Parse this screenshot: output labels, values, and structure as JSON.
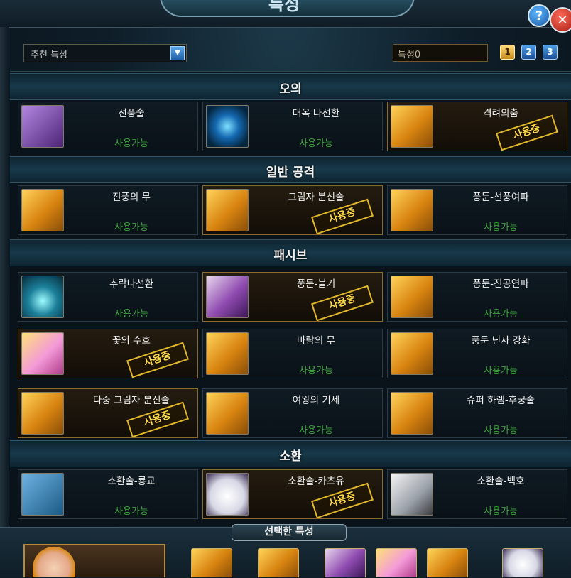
{
  "window": {
    "title": "특성",
    "help_label": "?",
    "close_label": "✕",
    "accent": "#1c5ca8",
    "used_color": "#ffd94b",
    "available_color": "#3fa43f"
  },
  "controls": {
    "preset_select": "추천 특성",
    "trait_name": "특성0",
    "pages": [
      "1",
      "2",
      "3"
    ],
    "active_page": "1"
  },
  "sections": [
    {
      "title": "오의",
      "skills": [
        {
          "name": "선풍술",
          "status": "사용가능",
          "icon": "tornado-icon"
        },
        {
          "name": "대옥 나선환",
          "status": "사용가능",
          "icon": "spiral-orb-icon"
        },
        {
          "name": "격려의춤",
          "status": "사용중",
          "icon": "dancer-icon"
        }
      ]
    },
    {
      "title": "일반 공격",
      "skills": [
        {
          "name": "진풍의 무",
          "status": "사용가능",
          "icon": "wind-swirl-icon"
        },
        {
          "name": "그림자 분신술",
          "status": "사용중",
          "icon": "shadow-clone-icon"
        },
        {
          "name": "풍둔-선풍여파",
          "status": "사용가능",
          "icon": "flame-wave-icon"
        }
      ]
    },
    {
      "title": "패시브",
      "skills": [
        {
          "name": "추락나선환",
          "status": "사용가능",
          "icon": "falling-spiral-icon"
        },
        {
          "name": "풍둔-불기",
          "status": "사용중",
          "icon": "fan-icon"
        },
        {
          "name": "풍둔-진공연파",
          "status": "사용가능",
          "icon": "vacuum-wave-icon"
        },
        {
          "name": "꽃의 수호",
          "status": "사용중",
          "icon": "flower-guard-icon"
        },
        {
          "name": "바람의 무",
          "status": "사용가능",
          "icon": "scroll-icon"
        },
        {
          "name": "풍둔 닌자 강화",
          "status": "사용가능",
          "icon": "wind-kanji-icon"
        },
        {
          "name": "다중 그림자 분신술",
          "status": "사용중",
          "icon": "multi-clone-icon"
        },
        {
          "name": "여왕의 기세",
          "status": "사용가능",
          "icon": "queen-icon"
        },
        {
          "name": "슈퍼 하렘-후궁술",
          "status": "사용가능",
          "icon": "harem-icon"
        }
      ]
    },
    {
      "title": "소환",
      "skills": [
        {
          "name": "소환술-룡교",
          "status": "사용가능",
          "icon": "dragon-icon"
        },
        {
          "name": "소환술-카츠유",
          "status": "사용중",
          "icon": "slug-icon"
        },
        {
          "name": "소환술-백호",
          "status": "사용가능",
          "icon": "white-tiger-icon"
        }
      ]
    }
  ],
  "selected": {
    "title": "선택한 특성",
    "icons": [
      "dancer-icon",
      "shadow-clone-icon",
      "fan-icon",
      "flower-guard-icon",
      "multi-clone-icon",
      "slug-icon"
    ]
  }
}
